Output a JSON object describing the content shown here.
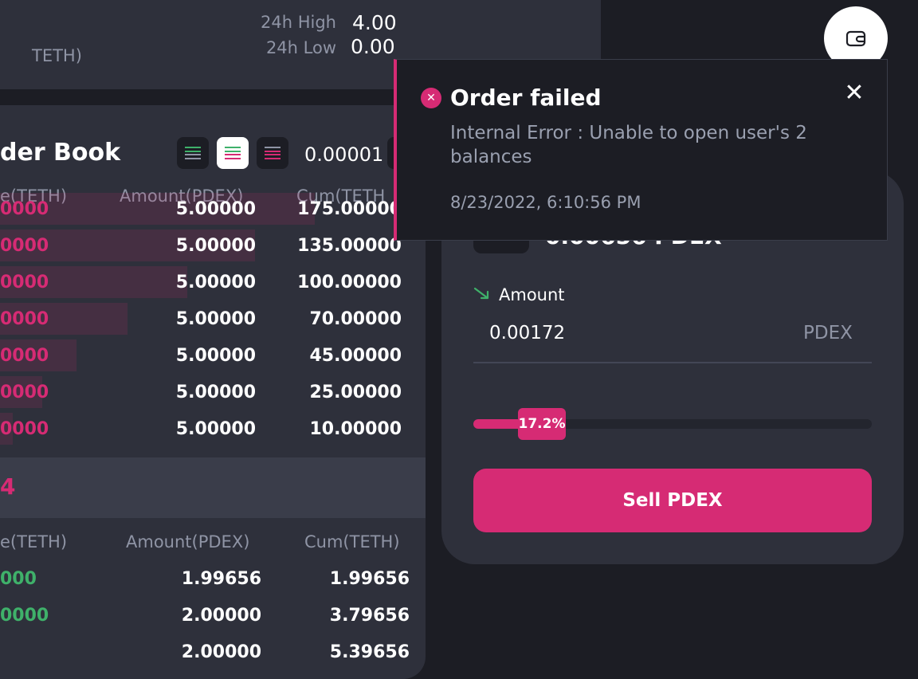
{
  "ticker": {
    "pair_fragment": "TETH)",
    "high_label": "24h High",
    "high_value": "4.00",
    "low_label": "24h Low",
    "low_value": "0.00"
  },
  "order_book": {
    "title": "der Book",
    "tick_size": "0.00001",
    "columns": {
      "price": "e(TETH)",
      "amount": "Amount(PDEX)",
      "cum": "Cum(TETH"
    },
    "asks": [
      {
        "price": "0000",
        "amount": "5.00000",
        "cum": "175.00000",
        "depth": 0.74
      },
      {
        "price": "0000",
        "amount": "5.00000",
        "cum": "135.00000",
        "depth": 0.6
      },
      {
        "price": "0000",
        "amount": "5.00000",
        "cum": "100.00000",
        "depth": 0.44
      },
      {
        "price": "0000",
        "amount": "5.00000",
        "cum": "70.00000",
        "depth": 0.3
      },
      {
        "price": "0000",
        "amount": "5.00000",
        "cum": "45.00000",
        "depth": 0.18
      },
      {
        "price": "0000",
        "amount": "5.00000",
        "cum": "25.00000",
        "depth": 0.1
      },
      {
        "price": "0000",
        "amount": "5.00000",
        "cum": "10.00000",
        "depth": 0.03
      }
    ],
    "last_price": "4",
    "bid_columns": {
      "price": "e(TETH)",
      "amount": "Amount(PDEX)",
      "cum": "Cum(TETH)"
    },
    "bids": [
      {
        "price": "000",
        "amount": "1.99656",
        "cum": "1.99656"
      },
      {
        "price": "0000",
        "amount": "2.00000",
        "cum": "3.79656"
      },
      {
        "price": "",
        "amount": "2.00000",
        "cum": "5.39656"
      }
    ]
  },
  "trade": {
    "balance": "0.00656 PDEX",
    "amount_label": "Amount",
    "amount_value": "0.00172",
    "amount_unit": "PDEX",
    "slider_percent": 17.2,
    "slider_label": "17.2%",
    "sell_label": "Sell PDEX",
    "colors": {
      "accent": "#d62b74",
      "buy": "#3fb16a"
    }
  },
  "toast": {
    "title": "Order failed",
    "message": "Internal Error : Unable to open user's 2 balances",
    "timestamp": "8/23/2022, 6:10:56 PM",
    "close_icon": "close-icon",
    "status_icon": "error-icon"
  },
  "wallet": {
    "icon": "wallet-icon"
  }
}
